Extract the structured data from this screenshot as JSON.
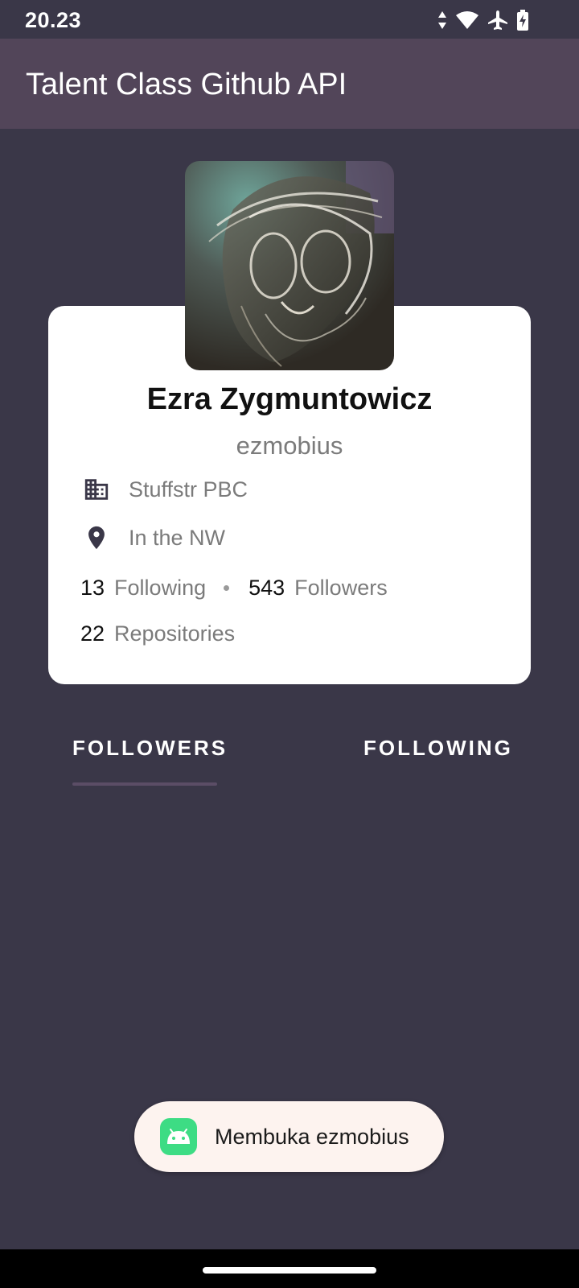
{
  "status_bar": {
    "time": "20.23",
    "icons": [
      "data-arrows-icon",
      "wifi-icon",
      "airplane-mode-icon",
      "battery-charging-icon"
    ]
  },
  "app_bar": {
    "title": "Talent Class Github API"
  },
  "profile": {
    "avatar_description": "user-avatar",
    "name": "Ezra Zygmuntowicz",
    "username": "ezmobius",
    "company": "Stuffstr PBC",
    "location": "In the NW",
    "following_count": "13",
    "following_label": "Following",
    "followers_count": "543",
    "followers_label": "Followers",
    "repositories_count": "22",
    "repositories_label": "Repositories"
  },
  "tabs": [
    {
      "label": "FOLLOWERS",
      "selected": true
    },
    {
      "label": "FOLLOWING",
      "selected": false
    }
  ],
  "toast": {
    "text": "Membuka ezmobius"
  },
  "colors": {
    "background": "#3a3748",
    "app_bar": "#524559",
    "card": "#ffffff",
    "tab_indicator": "#5b4d66",
    "toast_bg": "#fdf3ef",
    "android_green": "#3ddc84"
  }
}
